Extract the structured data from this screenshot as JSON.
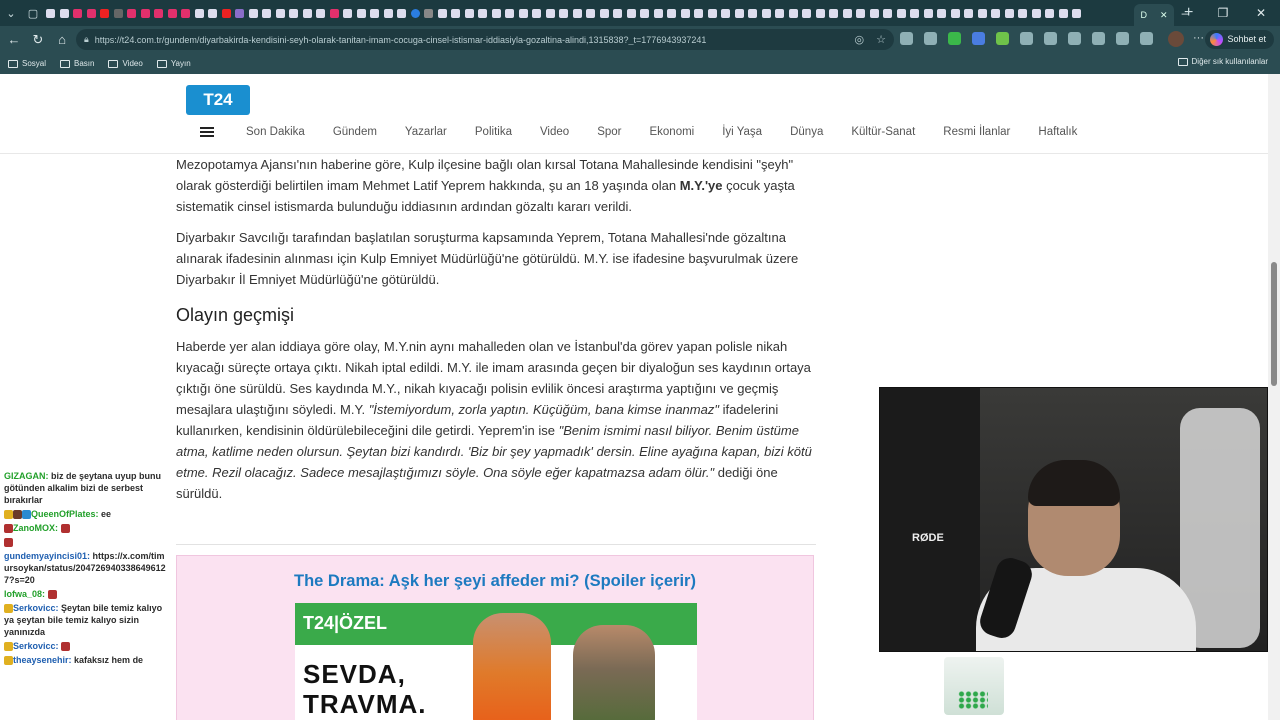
{
  "tabs": {
    "active_label": "D"
  },
  "address": {
    "url": "https://t24.com.tr/gundem/diyarbakirda-kendisini-seyh-olarak-tanitan-imam-cocuga-cinsel-istismar-iddiasiyla-gozaltina-alindi,1315838?_t=1776943937241"
  },
  "toolbar": {
    "chat_label": "Sohbet et"
  },
  "bookmarks": {
    "items": [
      {
        "label": "Sosyal"
      },
      {
        "label": "Basın"
      },
      {
        "label": "Video"
      },
      {
        "label": "Yayın"
      }
    ],
    "other": "Diğer sık kullanılanlar"
  },
  "site": {
    "logo": "T24",
    "menu": [
      "Son Dakika",
      "Gündem",
      "Yazarlar",
      "Politika",
      "Video",
      "Spor",
      "Ekonomi",
      "İyi Yaşa",
      "Dünya",
      "Kültür-Sanat",
      "Resmi İlanlar",
      "Haftalık"
    ]
  },
  "article": {
    "p1_a": "Mezopotamya Ajansı'nın haberine göre, Kulp ilçesine bağlı olan kırsal Totana Mahallesinde kendisini \"şeyh\" olarak gösterdiği belirtilen imam Mehmet Latif Yeprem hakkında, şu an 18 yaşında olan ",
    "p1_b": "M.Y.'ye",
    "p1_c": " çocuk yaşta sistematik cinsel istismarda bulunduğu iddiasının ardından gözaltı kararı verildi.",
    "p2": "Diyarbakır Savcılığı tarafından başlatılan soruşturma kapsamında Yeprem, Totana Mahallesi'nde gözaltına alınarak ifadesinin alınması için Kulp Emniyet Müdürlüğü'ne götürüldü. M.Y. ise ifadesine başvurulmak üzere Diyarbakır İl Emniyet Müdürlüğü'ne götürüldü.",
    "heading": "Olayın geçmişi",
    "p3_a": "Haberde yer alan iddiaya göre olay, M.Y.nin aynı mahalleden olan ve İstanbul'da görev yapan polisle nikah kıyacağı süreçte ortaya çıktı. Nikah iptal edildi. M.Y. ile imam arasında geçen bir diyaloğun ses kaydının ortaya çıktığı öne sürüldü. Ses kaydında M.Y., nikah kıyacağı polisin evlilik öncesi araştırma yaptığını ve geçmiş mesajlara ulaştığını söyledi. M.Y. ",
    "p3_q1": "\"İstemiyordum, zorla yaptın. Küçüğüm, bana kimse inanmaz\"",
    "p3_b": " ifadelerini kullanırken, kendisinin öldürülebileceğini dile getirdi. Yeprem'in ise ",
    "p3_q2": "\"Benim ismimi nasıl biliyor. Benim üstüme atma, katlime neden olursun. Şeytan bizi kandırdı. 'Biz bir şey yapmadık' dersin. Eline ayağına kapan, bizi kötü etme. Rezil olacağız. Sadece mesajlaştığımızı söyle. Ona söyle eğer kapatmazsa adam ölür.\"",
    "p3_c": " dediği öne sürüldü."
  },
  "promo": {
    "title": "The Drama: Aşk her şeyi affeder mi? (Spoiler içerir)",
    "badge": "T24|ÖZEL",
    "big_text": "SEVDA,\nTRAVMA."
  },
  "chat": [
    {
      "user": "GIZAGAN:",
      "text": " biz de şeytana uyup bunu götünden alkalim bizi de serbest bırakırlar",
      "color": "#22a02a"
    },
    {
      "user": "QueenOfPlates:",
      "text": " ee",
      "color": "#22a02a"
    },
    {
      "user": "ZanoMOX:",
      "text": "",
      "color": "#22a02a"
    },
    {
      "user": "gundemyayincisi01:",
      "text": " https://x.com/timursoykan/status/2047269403386496127?s=20",
      "color": "#1f5fb0"
    },
    {
      "user": "lofwa_08:",
      "text": "",
      "color": "#22a02a"
    },
    {
      "user": "Serkovicc:",
      "text": " Şeytan bile temiz kalıyo ya şeytan bile temiz kalıyo sizin yanınızda",
      "color": "#1f5fb0"
    },
    {
      "user": "Serkovicc:",
      "text": "",
      "color": "#1f5fb0"
    },
    {
      "user": "theaysenehir:",
      "text": " kafaksız hem de",
      "color": "#1f5fb0"
    }
  ],
  "webcam": {
    "brand": "RØDE"
  }
}
